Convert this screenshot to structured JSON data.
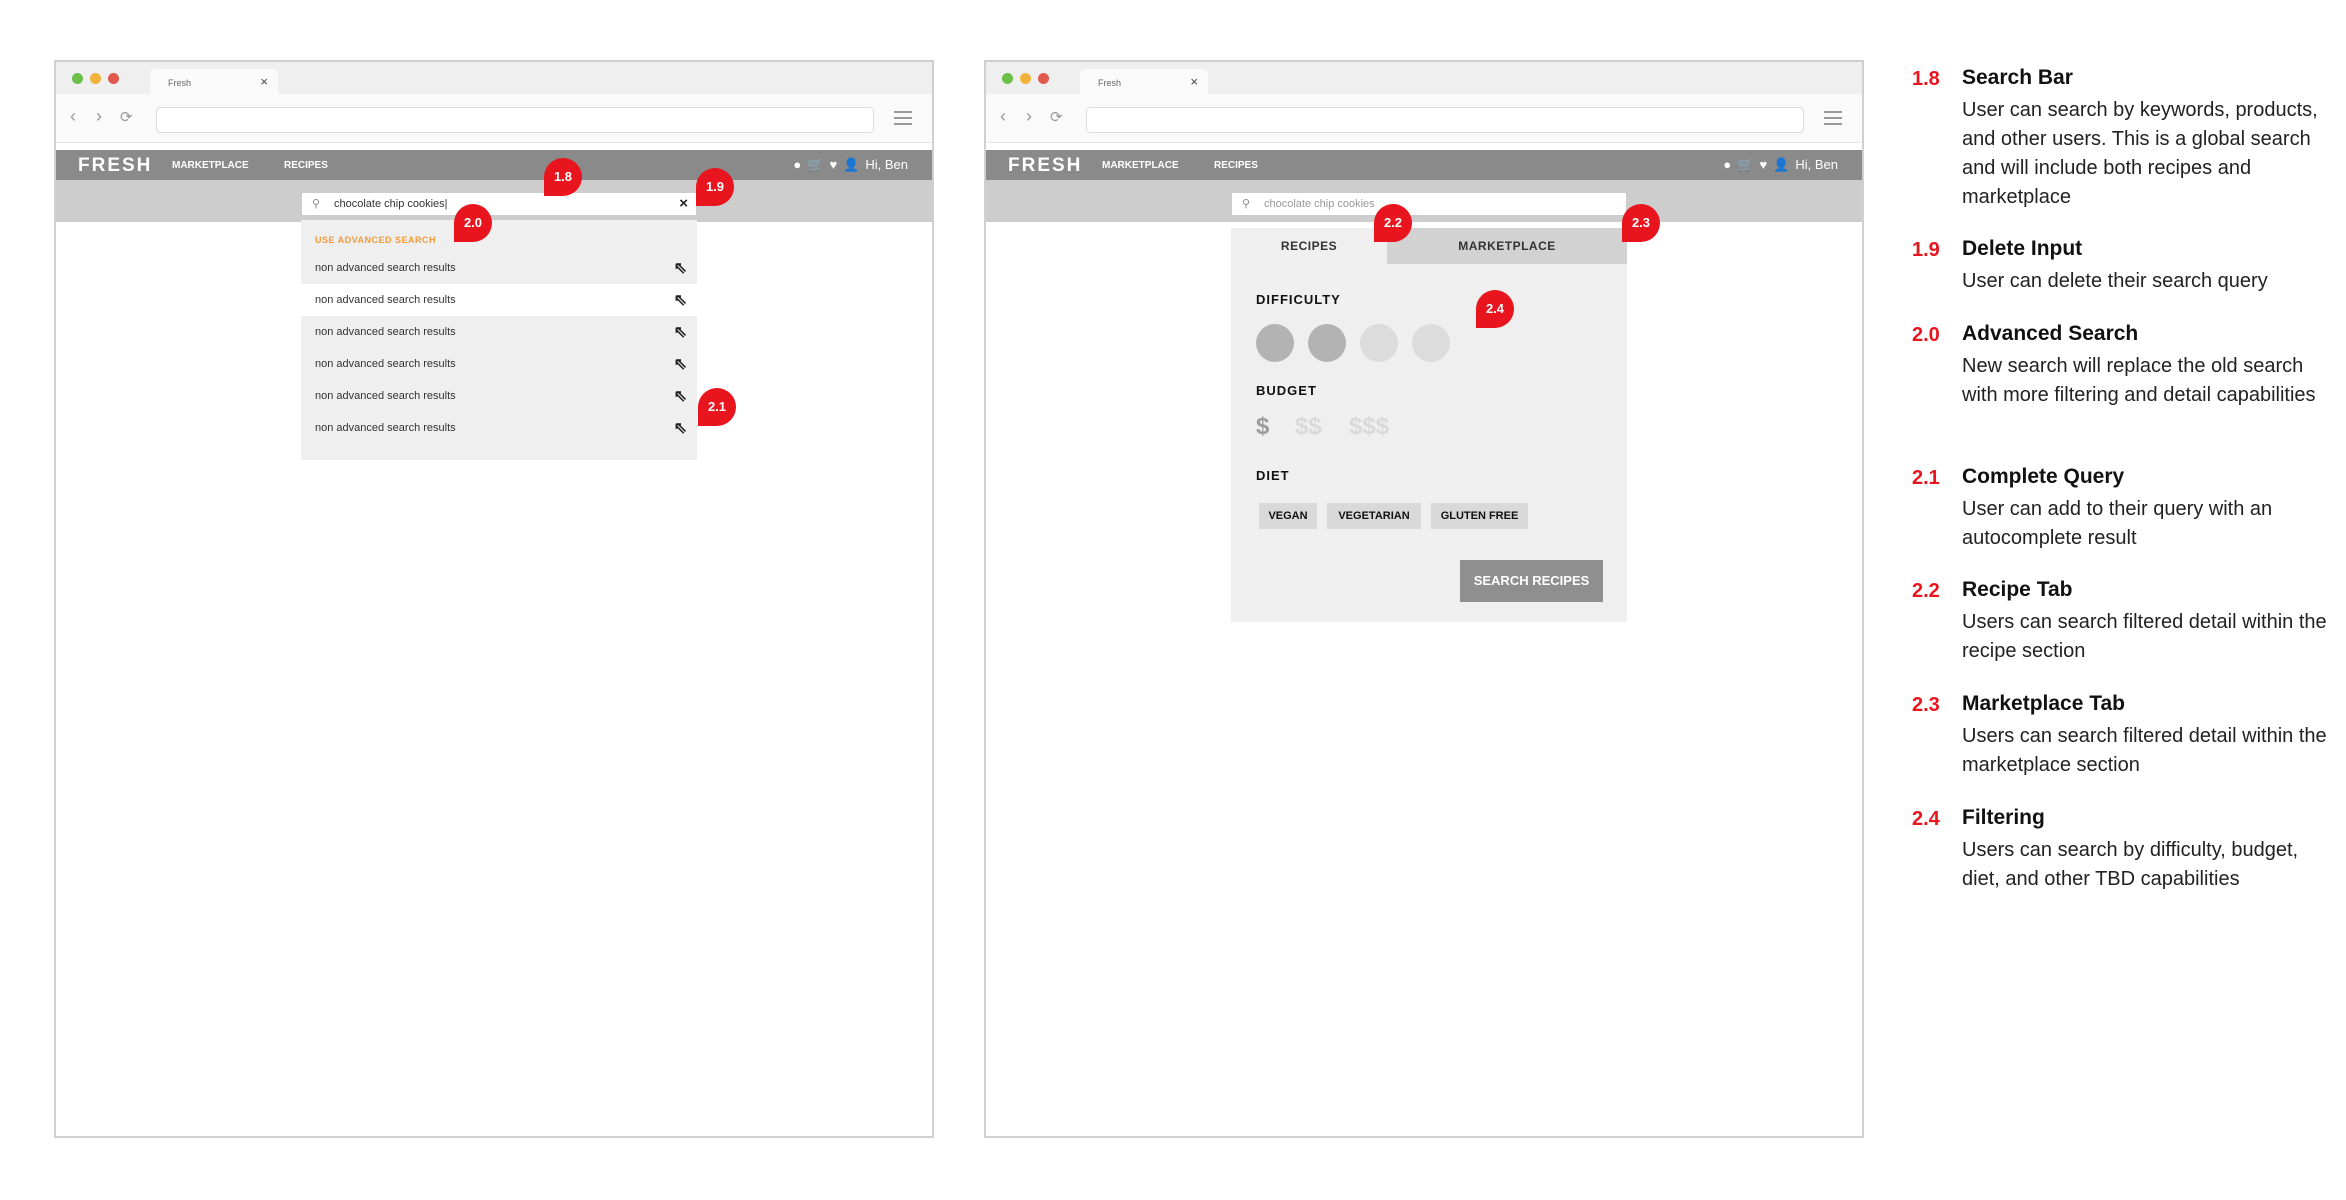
{
  "left_window": {
    "tab_title": "Fresh",
    "tab_close": "×",
    "brand": "FRESH",
    "nav": [
      "MARKETPLACE",
      "RECIPES"
    ],
    "user_greeting": "Hi, Ben",
    "search_value": "chocolate chip cookies|",
    "clear_icon": "×",
    "advanced_link": "USE ADVANCED SEARCH",
    "results": [
      "non advanced search results",
      "non advanced search results",
      "non advanced search results",
      "non advanced search results",
      "non advanced search results",
      "non advanced search results"
    ],
    "result_icon": "arrow-up-left-icon"
  },
  "right_window": {
    "tab_title": "Fresh",
    "tab_close": "×",
    "brand": "FRESH",
    "nav": [
      "MARKETPLACE",
      "RECIPES"
    ],
    "user_greeting": "Hi, Ben",
    "search_placeholder": "chocolate chip cookies",
    "tabs": [
      "RECIPES",
      "MARKETPLACE"
    ],
    "active_tab": "RECIPES",
    "difficulty_label": "DIFFICULTY",
    "difficulty_selected": 2,
    "difficulty_total": 4,
    "budget_label": "BUDGET",
    "budget_options": [
      "$",
      "$$",
      "$$$"
    ],
    "budget_selected": "$",
    "diet_label": "DIET",
    "diet_options": [
      "VEGAN",
      "VEGETARIAN",
      "GLUTEN FREE"
    ],
    "search_button": "SEARCH RECIPES"
  },
  "callouts": [
    "1.8",
    "1.9",
    "2.0",
    "2.1",
    "2.2",
    "2.3",
    "2.4"
  ],
  "legend": [
    {
      "num": "1.8",
      "title": "Search Bar",
      "desc": "User can search by keywords, products, and other users. This is a global search and will include both recipes and marketplace"
    },
    {
      "num": "1.9",
      "title": "Delete Input",
      "desc": "User can delete their search query"
    },
    {
      "num": "2.0",
      "title": "Advanced Search",
      "desc": "New search will replace the old search with more filtering and detail capabilities"
    },
    {
      "num": "2.1",
      "title": "Complete Query",
      "desc": "User can add to their query with an autocomplete result"
    },
    {
      "num": "2.2",
      "title": "Recipe Tab",
      "desc": "Users can search filtered detail within the recipe section"
    },
    {
      "num": "2.3",
      "title": "Marketplace Tab",
      "desc": "Users can search filtered detail within the marketplace section"
    },
    {
      "num": "2.4",
      "title": "Filtering",
      "desc": "Users can search by difficulty, budget, diet, and other TBD capabilities"
    }
  ],
  "colors": {
    "accent": "#e8141e",
    "advanced_link": "#f29a3a",
    "nav_bar": "#8a8a8a",
    "band": "#cdcdcd"
  }
}
